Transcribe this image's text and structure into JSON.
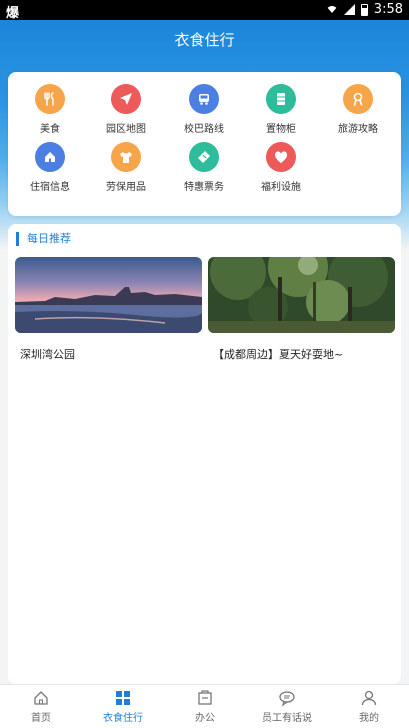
{
  "statusbar": {
    "left_text": "爆",
    "time": "3:58"
  },
  "header": {
    "title": "衣食住行"
  },
  "grid": {
    "items": [
      {
        "label": "美食",
        "icon": "food-icon",
        "color": "#f6a54a"
      },
      {
        "label": "园区地图",
        "icon": "map-navigation-icon",
        "color": "#ec5a5a"
      },
      {
        "label": "校巴路线",
        "icon": "bus-icon",
        "color": "#4b7fe2"
      },
      {
        "label": "置物柜",
        "icon": "locker-icon",
        "color": "#2ebc9a"
      },
      {
        "label": "旅游攻略",
        "icon": "travel-guide-icon",
        "color": "#f6a54a"
      },
      {
        "label": "住宿信息",
        "icon": "home-icon",
        "color": "#4b7fe2"
      },
      {
        "label": "劳保用品",
        "icon": "shirt-icon",
        "color": "#f6a54a"
      },
      {
        "label": "特惠票务",
        "icon": "ticket-icon",
        "color": "#2ebc9a"
      },
      {
        "label": "福利设施",
        "icon": "heart-icon",
        "color": "#ec5a5a"
      }
    ]
  },
  "recommend": {
    "title": "每日推荐",
    "items": [
      {
        "caption": "深圳湾公园"
      },
      {
        "caption": "【成都周边】夏天好耍地~"
      }
    ]
  },
  "tabbar": {
    "tabs": [
      {
        "label": "首页",
        "icon": "home-tab-icon",
        "active": false
      },
      {
        "label": "衣食住行",
        "icon": "grid-tab-icon",
        "active": true
      },
      {
        "label": "办公",
        "icon": "office-tab-icon",
        "active": false
      },
      {
        "label": "员工有话说",
        "icon": "chat-tab-icon",
        "active": false
      },
      {
        "label": "我的",
        "icon": "profile-tab-icon",
        "active": false
      }
    ],
    "active_color": "#1f7fd6"
  }
}
